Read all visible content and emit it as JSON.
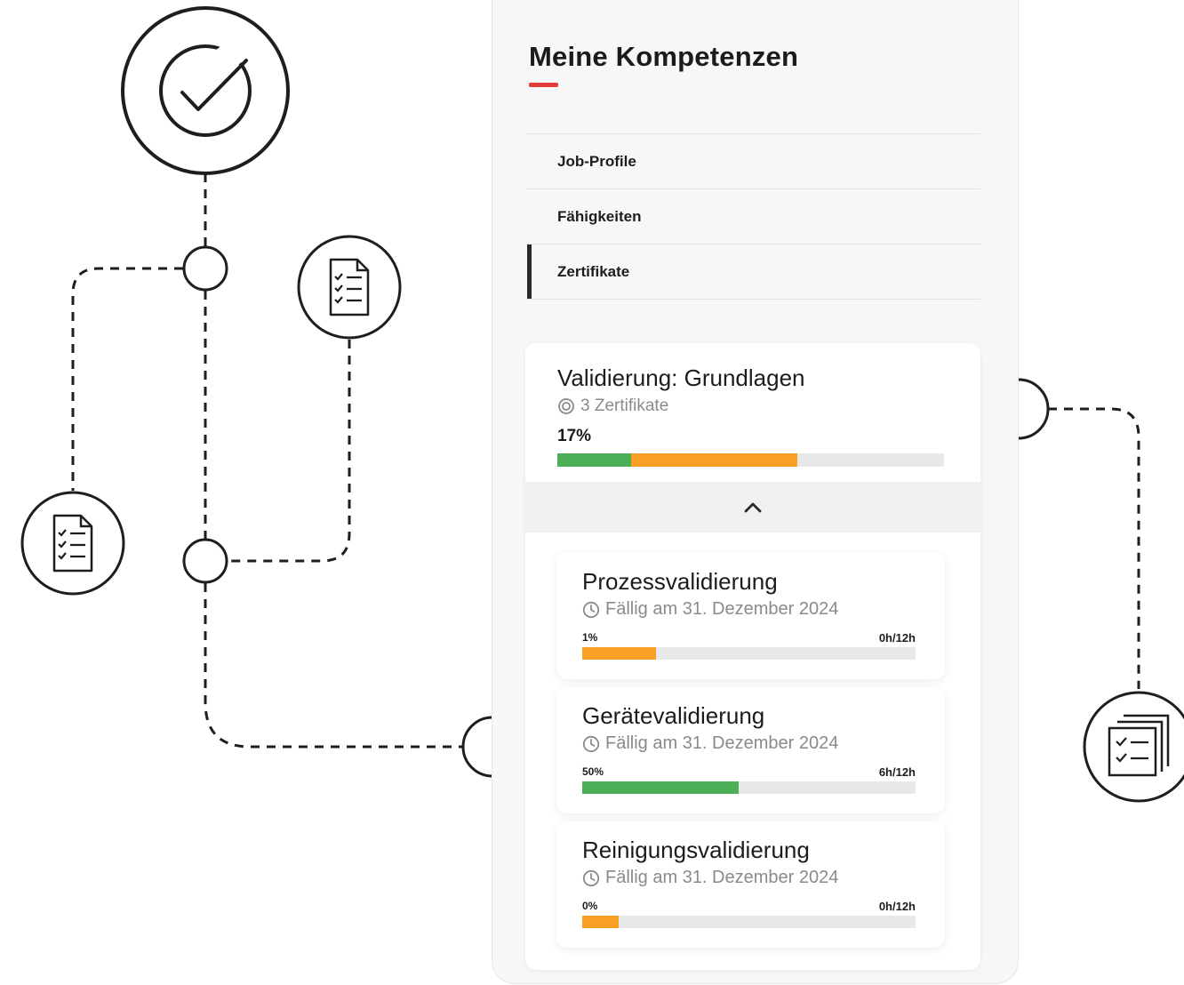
{
  "header": {
    "title": "Meine Kompetenzen"
  },
  "menu": {
    "items": [
      {
        "label": "Job-Profile",
        "active": false
      },
      {
        "label": "Fähigkeiten",
        "active": false
      },
      {
        "label": "Zertifikate",
        "active": true
      }
    ]
  },
  "certificate_group": {
    "title": "Validierung: Grundlagen",
    "count_label": "3 Zertifikate",
    "progress_label": "17%",
    "progress_segments": [
      {
        "status": "completed",
        "fraction": 0.19,
        "color": "#4cae56"
      },
      {
        "status": "in_progress",
        "fraction": 0.43,
        "color": "#f7a024"
      }
    ],
    "certificates": [
      {
        "title": "Prozessvalidierung",
        "due": "Fällig am 31. Dezember 2024",
        "progress_label": "1%",
        "hours": "0h/12h",
        "bar_fraction": 0.22,
        "bar_color": "#f7a024"
      },
      {
        "title": "Gerätevalidierung",
        "due": "Fällig am 31. Dezember 2024",
        "progress_label": "50%",
        "hours": "6h/12h",
        "bar_fraction": 0.47,
        "bar_color": "#4cae56"
      },
      {
        "title": "Reinigungsvalidierung",
        "due": "Fällig am 31. Dezember 2024",
        "progress_label": "0%",
        "hours": "0h/12h",
        "bar_fraction": 0.11,
        "bar_color": "#f7a024"
      }
    ]
  },
  "icons": {
    "top_badge": "checkmark-circle-icon",
    "doc_right": "checklist-document-icon",
    "doc_left": "checklist-document-icon",
    "stack_right": "stacked-checklists-icon",
    "chevron": "chevron-up-icon",
    "certificate": "certificate-icon",
    "clock": "clock-icon"
  },
  "colors": {
    "accent": "#e43d3d",
    "green": "#4cae56",
    "orange": "#f7a024",
    "track": "#e8e8e8"
  }
}
